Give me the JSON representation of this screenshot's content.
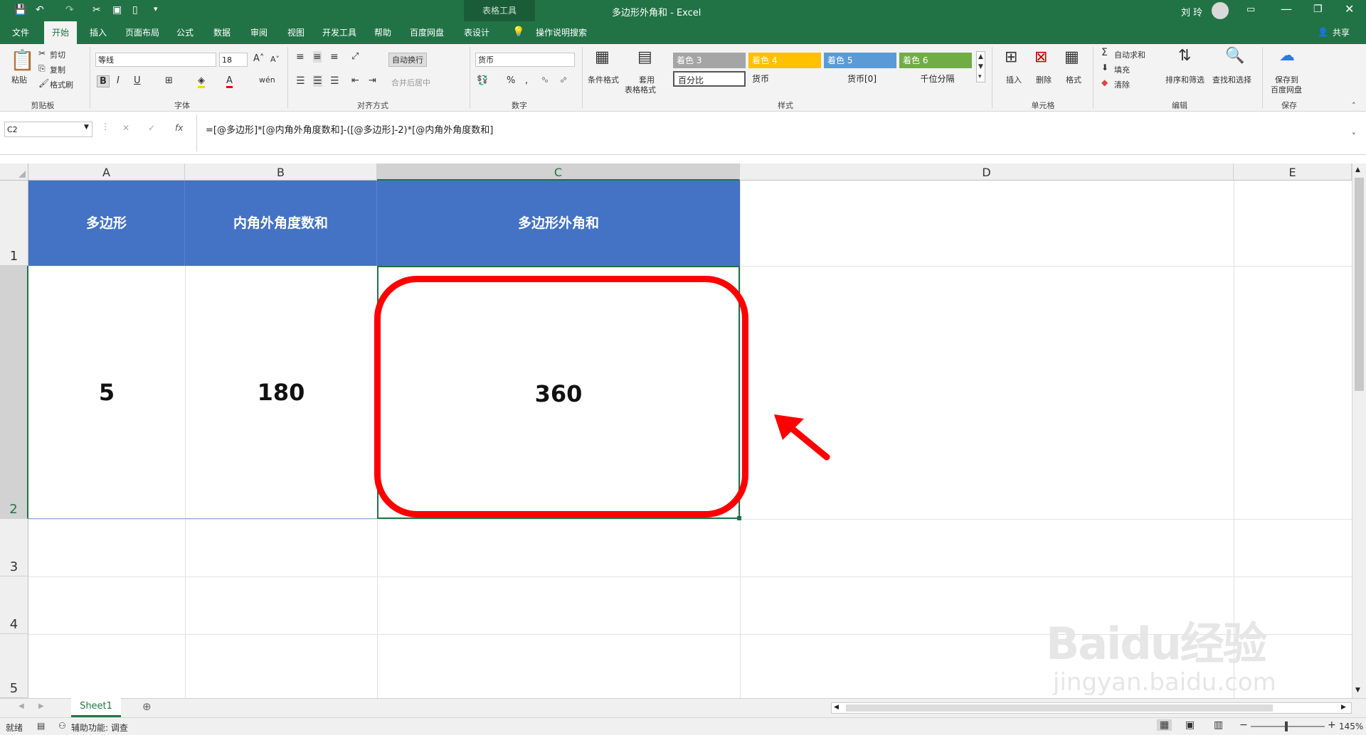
{
  "titlebar": {
    "context_tab": "表格工具",
    "doc_title": "多边形外角和  -  Excel",
    "user": "刘 玲"
  },
  "tabs": [
    "文件",
    "开始",
    "插入",
    "页面布局",
    "公式",
    "数据",
    "审阅",
    "视图",
    "开发工具",
    "帮助",
    "百度网盘",
    "表设计"
  ],
  "tell_me": "操作说明搜索",
  "share": "共享",
  "ribbon": {
    "clipboard": {
      "paste": "粘贴",
      "cut": "剪切",
      "copy": "复制",
      "format_painter": "格式刷",
      "label": "剪贴板"
    },
    "font": {
      "name": "等线",
      "size": "18",
      "label": "字体"
    },
    "align": {
      "wrap": "自动换行",
      "merge": "合并后居中",
      "label": "对齐方式"
    },
    "number": {
      "format": "货币",
      "label": "数字"
    },
    "styles": {
      "cond_format": "条件格式",
      "table_format_1": "套用",
      "table_format_2": "表格格式",
      "cells": [
        {
          "text": "着色 3",
          "bg": "#a5a5a5",
          "fg": "#ffffff"
        },
        {
          "text": "着色 4",
          "bg": "#ffc000",
          "fg": "#ffffff"
        },
        {
          "text": "着色 5",
          "bg": "#5b9bd5",
          "fg": "#ffffff"
        },
        {
          "text": "着色 6",
          "bg": "#70ad47",
          "fg": "#ffffff"
        },
        {
          "text": "百分比",
          "bg": "#ffffff",
          "fg": "#222222"
        },
        {
          "text": "货币",
          "bg": "#f3f3f3",
          "fg": "#222222"
        },
        {
          "text": "货币[0]",
          "bg": "#f3f3f3",
          "fg": "#222222"
        },
        {
          "text": "千位分隔",
          "bg": "#f3f3f3",
          "fg": "#222222"
        }
      ],
      "label": "样式"
    },
    "cells_grp": {
      "insert": "插入",
      "delete": "删除",
      "format": "格式",
      "label": "单元格"
    },
    "editing": {
      "autosum": "自动求和",
      "fill": "填充",
      "clear": "清除",
      "sort": "排序和筛选",
      "find": "查找和选择",
      "label": "编辑"
    },
    "save": {
      "line1": "保存到",
      "line2": "百度网盘",
      "label": "保存"
    }
  },
  "formula_bar": {
    "name_box": "C2",
    "fx": "fx",
    "formula": "=[@多边形]*[@内角外角度数和]-([@多边形]-2)*[@内角外角度数和]"
  },
  "columns": [
    "A",
    "B",
    "C",
    "D",
    "E"
  ],
  "rows": [
    "1",
    "2",
    "3",
    "4",
    "5"
  ],
  "table": {
    "headers": [
      "多边形",
      "内角外角度数和",
      "多边形外角和"
    ],
    "values": [
      "5",
      "180",
      "360"
    ]
  },
  "sheet_tab": "Sheet1",
  "status": {
    "ready": "就绪",
    "accessibility": "辅助功能: 调查",
    "zoom": "145%"
  },
  "colors": {
    "excel_green": "#217346",
    "header_blue": "#4472c4",
    "annotation_red": "#ff0000"
  },
  "watermark": {
    "brand": "Baidu经验",
    "url": "jingyan.baidu.com"
  }
}
